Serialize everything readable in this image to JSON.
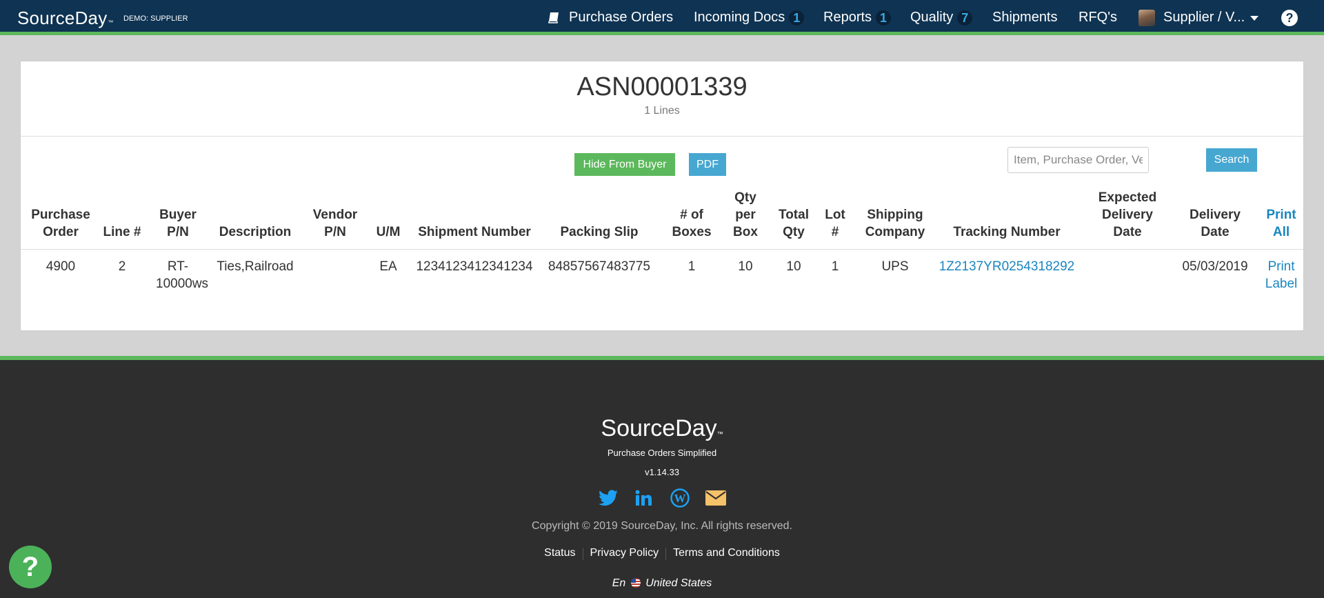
{
  "header": {
    "brand": "SourceDay",
    "brand_tm": "™",
    "mode": "DEMO: SUPPLIER",
    "nav": {
      "purchase_orders": "Purchase Orders",
      "incoming_docs": "Incoming Docs",
      "incoming_docs_count": "1",
      "reports": "Reports",
      "reports_count": "1",
      "quality": "Quality",
      "quality_count": "7",
      "shipments": "Shipments",
      "rfqs": "RFQ's",
      "user": "Supplier / V..."
    },
    "help": "?"
  },
  "shipment": {
    "title": "ASN00001339",
    "lines_count": "1 Lines"
  },
  "actions": {
    "hide_from_buyer": "Hide From Buyer",
    "pdf": "PDF",
    "search_placeholder": "Item, Purchase Order, Vendor Pa",
    "search": "Search"
  },
  "table": {
    "headers": {
      "purchase_order": "Purchase Order",
      "line": "Line #",
      "buyer_pn": "Buyer P/N",
      "description": "Description",
      "vendor_pn": "Vendor P/N",
      "um": "U/M",
      "shipment_number": "Shipment Number",
      "packing_slip": "Packing Slip",
      "boxes": "# of Boxes",
      "qty_per_box": "Qty per Box",
      "total_qty": "Total Qty",
      "lot": "Lot #",
      "shipping_company": "Shipping Company",
      "tracking_number": "Tracking Number",
      "expected_delivery": "Expected Delivery Date",
      "delivery_date": "Delivery Date",
      "print_all": "Print All"
    },
    "rows": [
      {
        "purchase_order": "4900",
        "line": "2",
        "buyer_pn": "RT-10000ws",
        "description": "Ties,Railroad",
        "vendor_pn": "",
        "um": "EA",
        "shipment_number": "1234123412341234",
        "packing_slip": "84857567483775",
        "boxes": "1",
        "qty_per_box": "10",
        "total_qty": "10",
        "lot": "1",
        "shipping_company": "UPS",
        "tracking_number": "1Z2137YR0254318292",
        "expected_delivery": "",
        "delivery_date": "05/03/2019",
        "print_label": "Print Label"
      }
    ]
  },
  "footer": {
    "logo": "SourceDay",
    "logo_tm": "™",
    "tagline": "Purchase Orders Simplified",
    "version": "v1.14.33",
    "socials": [
      "twitter-icon",
      "linkedin-icon",
      "wordpress-icon",
      "email-icon"
    ],
    "copyright": "Copyright © 2019 SourceDay, Inc. All rights reserved.",
    "links": {
      "status": "Status",
      "privacy": "Privacy Policy",
      "terms": "Terms and Conditions"
    },
    "language": "En",
    "country": "United States"
  },
  "help_bubble": "?",
  "colors": {
    "navbar": "#0f3352",
    "accent_green": "#5cb85c",
    "info_blue": "#46a7d1",
    "link_blue": "#1a86c0",
    "footer": "#2e2e2e",
    "social_blue": "#1da1f2",
    "email_gold": "#f5c169"
  }
}
